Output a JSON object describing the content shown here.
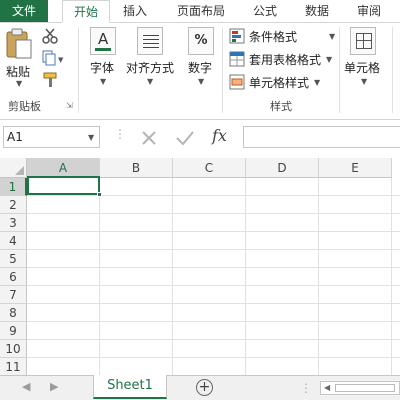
{
  "tabs": {
    "file": "文件",
    "home": "开始",
    "insert": "插入",
    "page_layout": "页面布局",
    "formulas": "公式",
    "data": "数据",
    "review": "审阅"
  },
  "ribbon": {
    "paste": "粘贴",
    "clipboard_group": "剪贴板",
    "font": "字体",
    "alignment": "对齐方式",
    "number": "数字",
    "conditional_format": "条件格式",
    "table_format": "套用表格格式",
    "cell_styles": "单元格样式",
    "styles_group": "样式",
    "cells": "单元格",
    "number_icon": "%",
    "font_icon": "A"
  },
  "formula_bar": {
    "name_box": "A1",
    "fx": "fx",
    "formula_value": ""
  },
  "grid": {
    "columns": [
      "A",
      "B",
      "C",
      "D",
      "E"
    ],
    "rows": [
      "1",
      "2",
      "3",
      "4",
      "5",
      "6",
      "7",
      "8",
      "9",
      "10",
      "11"
    ],
    "selected_cell": "A1"
  },
  "sheets": {
    "active": "Sheet1",
    "add_label": "+"
  },
  "colors": {
    "accent": "#217346",
    "header_bg": "#f3f3f3",
    "gridline": "#e1e1e1"
  }
}
